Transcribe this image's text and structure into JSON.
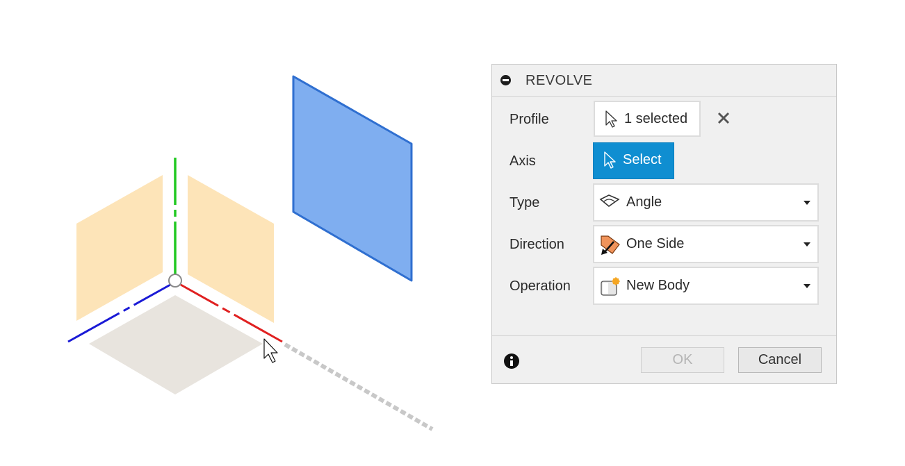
{
  "viewport": {
    "colors": {
      "x_axis": "#e02020",
      "y_axis": "#20c820",
      "z_axis": "#1a1ad6",
      "origin_plane": "#fde4b8",
      "ground_plane": "#e8e4de",
      "selected_profile": "#7faef0",
      "selected_profile_edge": "#2f6fd0"
    }
  },
  "dialog": {
    "title": "REVOLVE",
    "profile": {
      "label": "Profile",
      "value": "1 selected"
    },
    "axis": {
      "label": "Axis",
      "button": "Select"
    },
    "type": {
      "label": "Type",
      "value": "Angle"
    },
    "direction": {
      "label": "Direction",
      "value": "One Side"
    },
    "operation": {
      "label": "Operation",
      "value": "New Body"
    },
    "ok": "OK",
    "cancel": "Cancel",
    "accent": "#0f8ed1"
  }
}
